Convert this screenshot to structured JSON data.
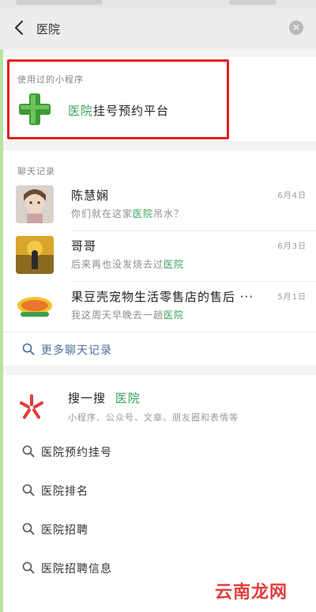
{
  "search": {
    "query": "医院"
  },
  "mini_programs": {
    "header": "使用过的小程序",
    "items": [
      {
        "prefix": "医院",
        "suffix": "挂号预约平台"
      }
    ]
  },
  "chat_history": {
    "header": "聊天记录",
    "items": [
      {
        "name": "陈慧娴",
        "msg_prefix": "你们就在这家",
        "msg_keyword": "医院",
        "msg_suffix": "吊水？",
        "date": "6月4日"
      },
      {
        "name": "哥哥",
        "msg_prefix": "后来再也没发烧去过",
        "msg_keyword": "医院",
        "msg_suffix": "",
        "date": "6月3日"
      },
      {
        "name": "果豆壳宠物生活零售店的售后 ···",
        "msg_prefix": "我这周天早晚去一趟",
        "msg_keyword": "医院",
        "msg_suffix": "",
        "date": "5月1日"
      }
    ],
    "more": "更多聊天记录"
  },
  "sou_yi_sou": {
    "title": "搜一搜",
    "keyword": "医院",
    "subtitle": "小程序、公众号、文章、朋友圈和表情等"
  },
  "suggestions": [
    "医院预约挂号",
    "医院排名",
    "医院招聘",
    "医院招聘信息"
  ],
  "watermark": "云南龙网",
  "colors": {
    "highlight": "#3aa35b",
    "link": "#4a6f9a",
    "red_box": "#e02020",
    "accent_strip": "#b7e3a0"
  },
  "icons": [
    "back-arrow-icon",
    "clear-icon",
    "cross-logo-icon",
    "search-icon",
    "sou-yi-sou-icon"
  ]
}
